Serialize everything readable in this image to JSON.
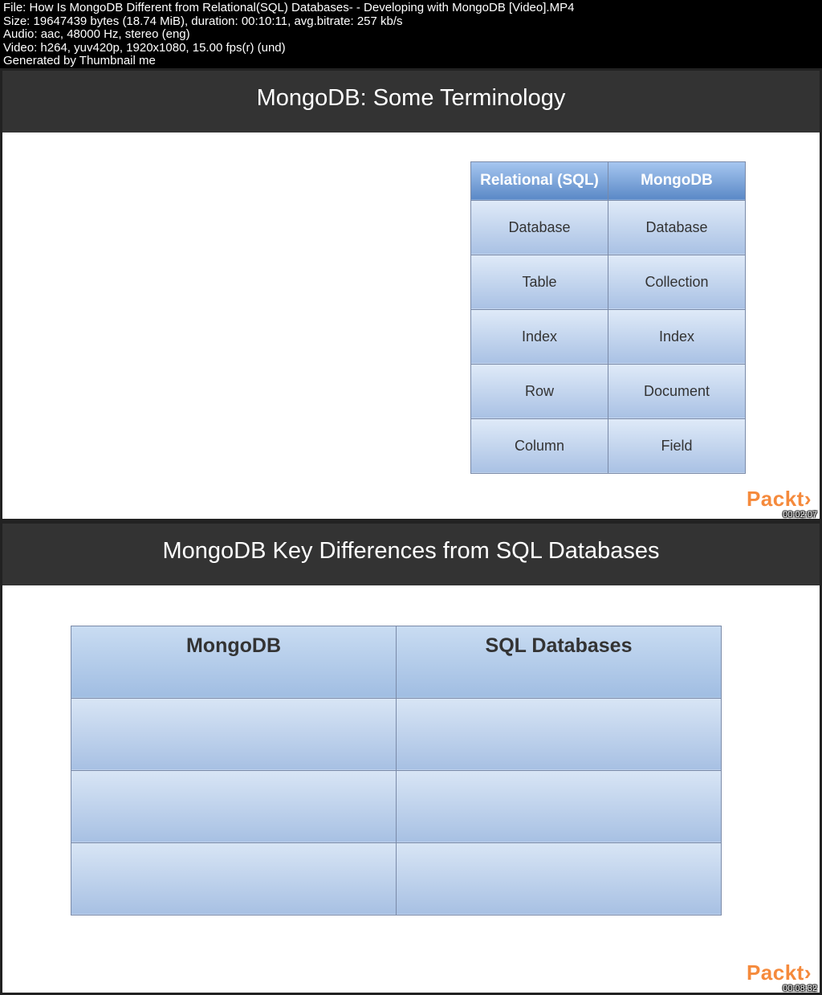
{
  "meta": {
    "file_line": "File: How Is MongoDB Different from Relational(SQL) Databases- - Developing with MongoDB [Video].MP4",
    "size_line": "Size: 19647439 bytes (18.74 MiB), duration: 00:10:11, avg.bitrate: 257 kb/s",
    "audio_line": "Audio: aac, 48000 Hz, stereo (eng)",
    "video_line": "Video: h264, yuv420p, 1920x1080, 15.00 fps(r) (und)",
    "generated_line": "Generated by Thumbnail me"
  },
  "thumb1": {
    "title": "MongoDB: Some Terminology",
    "table_headers": {
      "col1": "Relational (SQL)",
      "col2": "MongoDB"
    },
    "rows": [
      {
        "c1": "Database",
        "c2": "Database"
      },
      {
        "c1": "Table",
        "c2": "Collection"
      },
      {
        "c1": "Index",
        "c2": "Index"
      },
      {
        "c1": "Row",
        "c2": "Document"
      },
      {
        "c1": "Column",
        "c2": "Field"
      }
    ],
    "brand": "Packt",
    "brand_angle": "›",
    "timestamp": "00:02:07"
  },
  "thumb2": {
    "title": "MongoDB Key Differences from SQL Databases",
    "table_headers": {
      "col1": "MongoDB",
      "col2": "SQL Databases"
    },
    "rows": [
      {
        "c1": "",
        "c2": ""
      },
      {
        "c1": "",
        "c2": ""
      },
      {
        "c1": "",
        "c2": ""
      }
    ],
    "brand": "Packt",
    "brand_angle": "›",
    "timestamp": "00:08:32"
  }
}
